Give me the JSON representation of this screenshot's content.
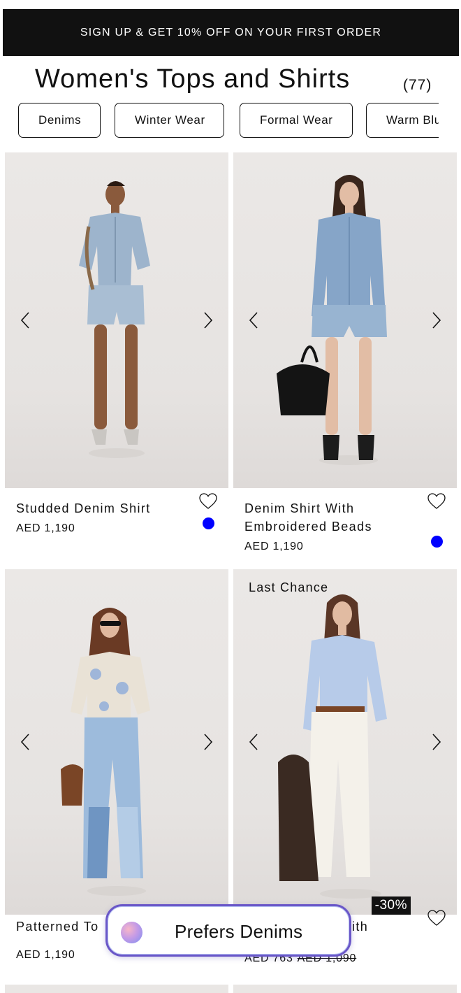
{
  "promo": {
    "text": "SIGN UP & GET 10% OFF ON YOUR FIRST ORDER"
  },
  "header": {
    "title": "Women's Tops and Shirts",
    "count": "(77)"
  },
  "chips": [
    {
      "label": "Denims"
    },
    {
      "label": "Winter Wear"
    },
    {
      "label": "Formal Wear"
    },
    {
      "label": "Warm Blu"
    }
  ],
  "products": [
    {
      "name": "Studded Denim Shirt",
      "price": "AED 1,190",
      "swatch_color": "#0000ff"
    },
    {
      "name": "Denim Shirt With Embroidered Beads",
      "price": "AED 1,190",
      "swatch_color": "#0000ff"
    },
    {
      "name": "Patterned To",
      "price": "AED 1,190"
    },
    {
      "badge": "Last Chance",
      "discount": "-30%",
      "name_visible": "ith",
      "price": "AED 763",
      "price_old": "AED 1,090"
    }
  ],
  "preference": {
    "label": "Prefers Denims"
  },
  "colors": {
    "promo_bg": "#111111",
    "swatch": "#0000ff",
    "pill_border": "#6a57c8"
  },
  "icons": [
    "chevron-left-icon",
    "chevron-right-icon",
    "heart-icon",
    "color-swatch",
    "preference-gradient-icon"
  ]
}
